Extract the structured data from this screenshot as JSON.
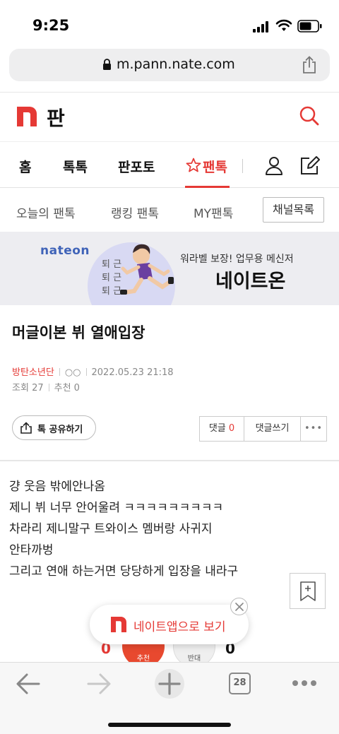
{
  "status_bar": {
    "time": "9:25"
  },
  "browser": {
    "url": "m.pann.nate.com",
    "tab_count": "28"
  },
  "header": {
    "title": "판"
  },
  "main_nav": {
    "items": [
      "홈",
      "톡톡",
      "판포토",
      "팬톡"
    ],
    "active": "팬톡"
  },
  "sub_nav": {
    "items": [
      "오늘의 팬톡",
      "랭킹 팬톡",
      "MY팬톡"
    ],
    "channel_button": "채널목록"
  },
  "banner": {
    "brand": "nateon",
    "vertical_text": [
      "퇴 근",
      "퇴 근",
      "퇴 근"
    ],
    "tagline": "워라벨 보장! 업무용 메신저",
    "product": "네이트온"
  },
  "article": {
    "title": "머글이본 뷔 열애입장",
    "author": "방탄소년단",
    "author_id": "○○",
    "datetime": "2022.05.23 21:18",
    "views_label": "조회",
    "views": "27",
    "recommend_label": "추천",
    "recommend_count": "0",
    "share_label": "톡 공유하기",
    "comments_label": "댓글",
    "comments_count": "0",
    "write_comment_label": "댓글쓰기",
    "more_label": "•••",
    "body": [
      "걍 웃음 밖에안나옴",
      "제니 뷔 너무 안어울려 ㅋㅋㅋㅋㅋㅋㅋㅋㅋ",
      "차라리 제니말구 트와이스 멤버랑 사귀지",
      "안타까벙",
      "그리고 연애 하는거면 당당하게 입장을 내라구"
    ]
  },
  "votes": {
    "recommend_count": "0",
    "recommend_label": "추천",
    "oppose_count": "0",
    "oppose_label": "반대"
  },
  "floating_banner": {
    "text": "네이트앱으로 보기"
  },
  "colors": {
    "accent": "#e53935",
    "nateon_blue": "#3f63b8"
  }
}
